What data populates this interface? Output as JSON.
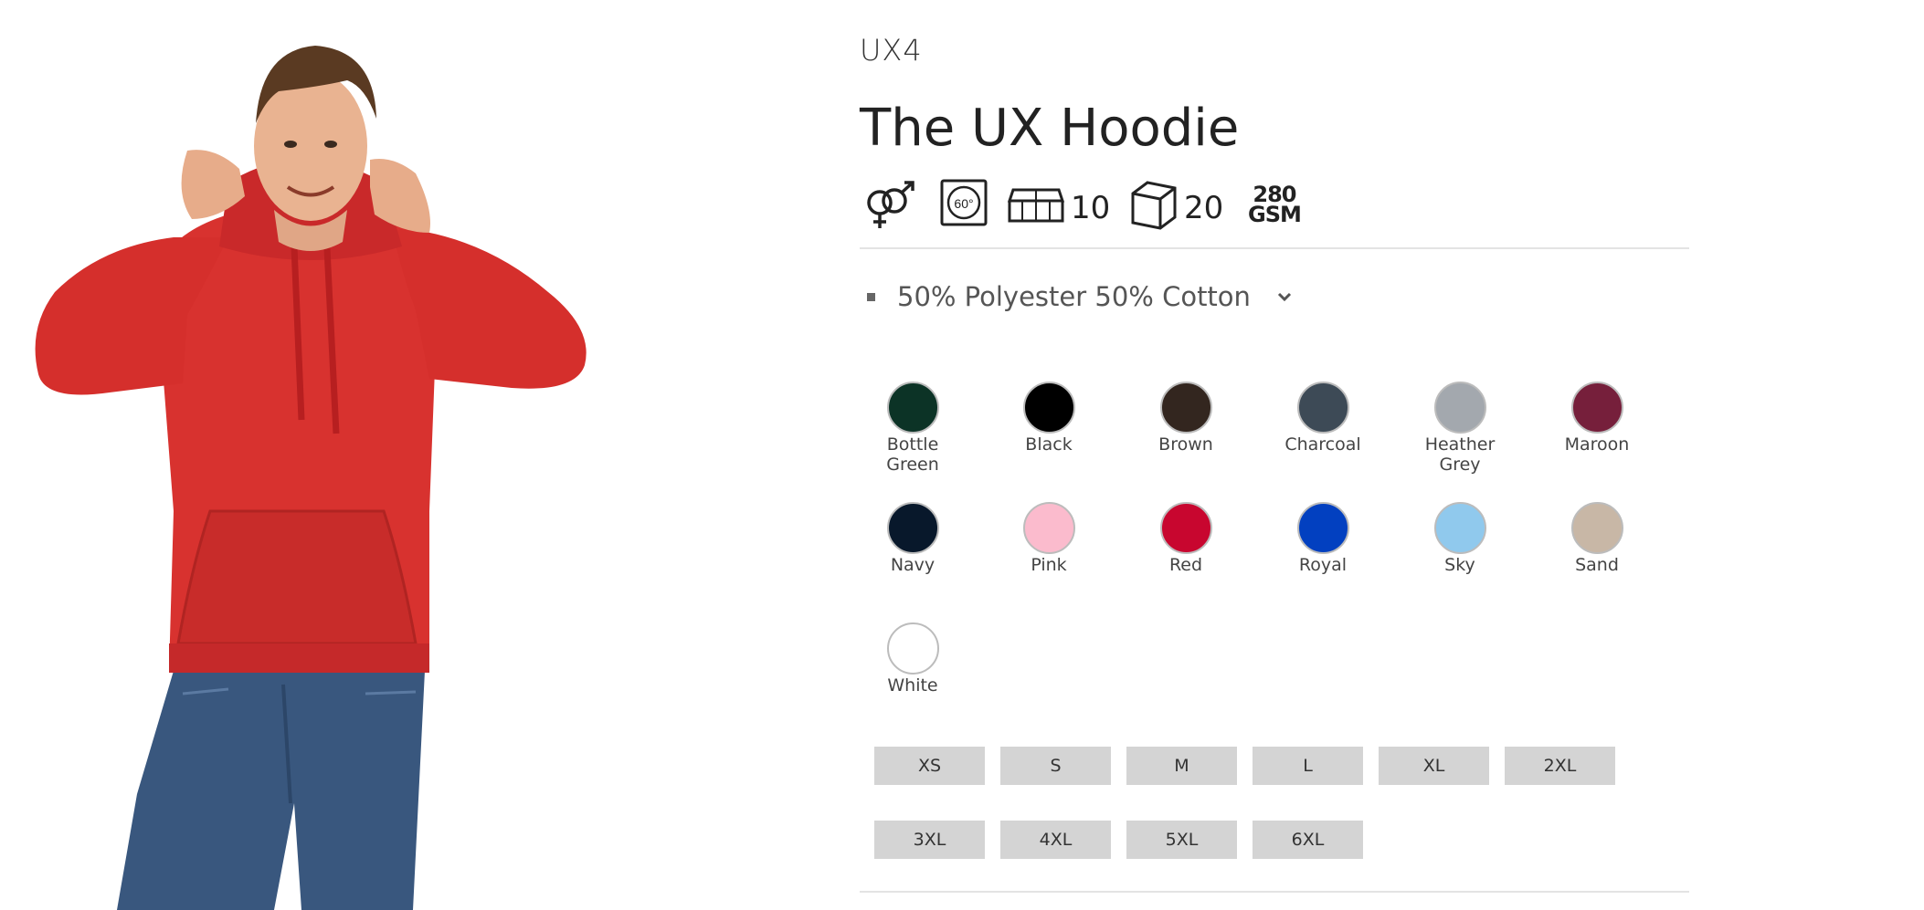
{
  "product": {
    "code": "UX4",
    "title": "The UX Hoodie",
    "image_alt": "Man wearing a red hoodie"
  },
  "icons": [
    {
      "name": "unisex-icon"
    },
    {
      "name": "wash-60-icon",
      "label": "60°"
    },
    {
      "name": "pack-icon",
      "value": "10"
    },
    {
      "name": "carton-box-icon",
      "value": "20"
    },
    {
      "name": "gsm-icon",
      "value": "280",
      "unit": "GSM"
    }
  ],
  "spec": {
    "text": "50% Polyester 50% Cotton"
  },
  "colours": [
    {
      "name": "Bottle Green",
      "line1": "Bottle",
      "line2": "Green",
      "hex": "#0c3326"
    },
    {
      "name": "Black",
      "line1": "Black",
      "line2": "",
      "hex": "#000000"
    },
    {
      "name": "Brown",
      "line1": "Brown",
      "line2": "",
      "hex": "#33261f"
    },
    {
      "name": "Charcoal",
      "line1": "Charcoal",
      "line2": "",
      "hex": "#3d4a56"
    },
    {
      "name": "Heather Grey",
      "line1": "Heather",
      "line2": "Grey",
      "hex": "#a3a8ae"
    },
    {
      "name": "Maroon",
      "line1": "Maroon",
      "line2": "",
      "hex": "#761f3b"
    },
    {
      "name": "Navy",
      "line1": "Navy",
      "line2": "",
      "hex": "#08182b"
    },
    {
      "name": "Pink",
      "line1": "Pink",
      "line2": "",
      "hex": "#fbbbcd"
    },
    {
      "name": "Red",
      "line1": "Red",
      "line2": "",
      "hex": "#c8062f"
    },
    {
      "name": "Royal",
      "line1": "Royal",
      "line2": "",
      "hex": "#0240c0"
    },
    {
      "name": "Sky",
      "line1": "Sky",
      "line2": "",
      "hex": "#90c9ed"
    },
    {
      "name": "Sand",
      "line1": "Sand",
      "line2": "",
      "hex": "#c8b7a6"
    },
    {
      "name": "White",
      "line1": "White",
      "line2": "",
      "hex": "#ffffff"
    }
  ],
  "sizes": [
    "XS",
    "S",
    "M",
    "L",
    "XL",
    "2XL",
    "3XL",
    "4XL",
    "5XL",
    "6XL"
  ]
}
